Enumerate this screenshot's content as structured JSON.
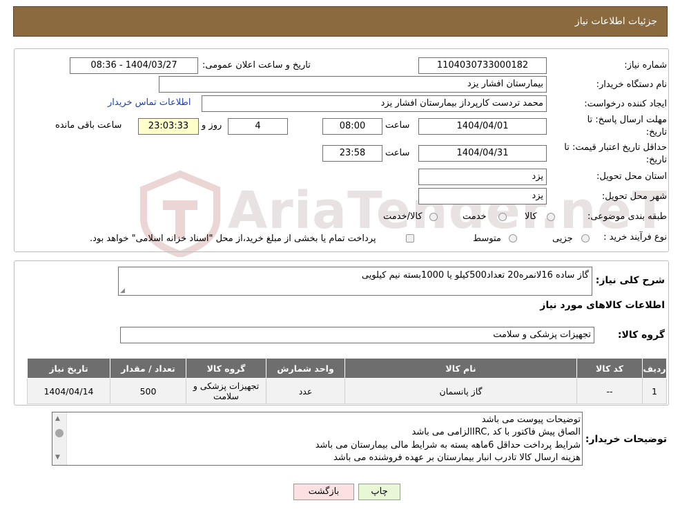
{
  "header": {
    "title": "جزئیات اطلاعات نیاز"
  },
  "form": {
    "need_number_label": "شماره نیاز:",
    "need_number": "1104030733000182",
    "announce_label": "تاریخ و ساعت اعلان عمومی:",
    "announce_value": "1404/03/27 - 08:36",
    "buyer_org_label": "نام دستگاه خریدار:",
    "buyer_org": "بیمارستان افشار یزد",
    "requester_label": "ایجاد کننده درخواست:",
    "requester": "محمد تردست کارپرداز بیمارستان افشار یزد",
    "contact_link": "اطلاعات تماس خریدار",
    "reply_deadline_label_1": "مهلت ارسال پاسخ: تا",
    "reply_deadline_label_2": "تاریخ:",
    "reply_date": "1404/04/01",
    "time_label": "ساعت",
    "reply_time": "08:00",
    "days_value": "4",
    "days_label": "روز و",
    "remaining_value": "23:03:33",
    "remaining_label": "ساعت باقی مانده",
    "price_validity_label_1": "حداقل تاریخ اعتبار قیمت: تا",
    "price_validity_label_2": "تاریخ:",
    "price_date": "1404/04/31",
    "price_time": "23:58",
    "province_label": "استان محل تحویل:",
    "province": "یزد",
    "city_label": "شهر محل تحویل:",
    "city": "یزد",
    "category_label": "طبقه بندی موضوعی:",
    "category_options": [
      "کالا",
      "خدمت",
      "کالا/خدمت"
    ],
    "purchase_type_label": "نوع فرآیند خرید :",
    "purchase_options": [
      "جزیی",
      "متوسط"
    ],
    "purchase_note": "پرداخت تمام یا بخشی از مبلغ خرید،از محل \"اسناد خزانه اسلامی\" خواهد بود."
  },
  "description": {
    "label": "شرح کلی نیاز:",
    "text": "گاز ساده 16لانمره20 تعداد500کیلو یا 1000بسته نیم کیلویی"
  },
  "goods": {
    "section_title": "اطلاعات کالاهای مورد نیاز",
    "group_label": "گروه کالا:",
    "group_value": "تجهیزات پزشکی و سلامت",
    "columns": [
      "ردیف",
      "کد کالا",
      "نام کالا",
      "واحد شمارش",
      "گروه کالا",
      "تعداد / مقدار",
      "تاریخ نیاز"
    ],
    "rows": [
      {
        "row": "1",
        "code": "--",
        "name": "گاز پانسمان",
        "unit": "عدد",
        "group": "تجهیزات پزشکی و سلامت",
        "qty": "500",
        "date": "1404/04/14"
      }
    ]
  },
  "notes": {
    "label": "توضیحات خریدار:",
    "lines": [
      "توضیحات پیوست می باشد",
      "الصاق پیش فاکتور با کد  ,IRCالزامی می باشد",
      "شرایط پرداخت   حداقل 6ماهه بسته به شرایط مالی بیمارستان می باشد",
      "هزینه ارسال کالا تادرب انبار بیمارستان بر عهده فروشنده می باشد"
    ]
  },
  "buttons": {
    "print": "چاپ",
    "back": "بازگشت"
  },
  "watermark": {
    "text": "AriaTender.neT"
  },
  "colors": {
    "header": "#8a6a3e",
    "table_header": "#6e6e6e",
    "link": "#1a3fb8",
    "yellow": "#ffffcc",
    "print_btn": "#e8f8d6",
    "back_btn": "#fbe1e1"
  }
}
